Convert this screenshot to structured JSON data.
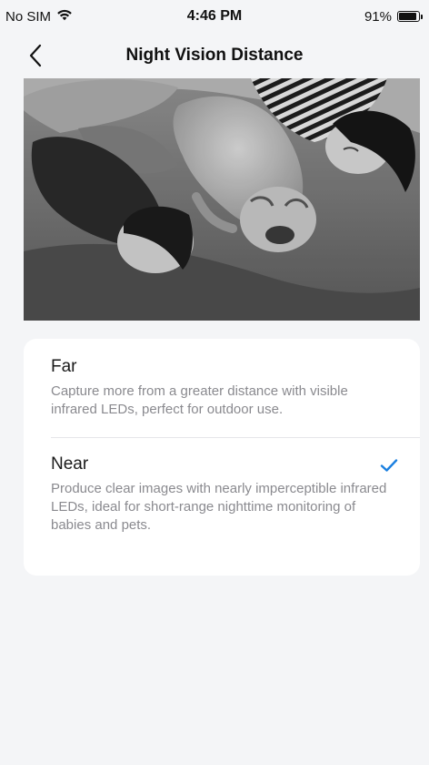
{
  "status_bar": {
    "carrier": "No SIM",
    "time": "4:46 PM",
    "battery_percent": "91%",
    "battery_level": 0.91,
    "wifi_icon": "wifi-icon",
    "battery_icon": "battery-icon"
  },
  "nav": {
    "title": "Night Vision Distance",
    "back_icon": "chevron-left-icon"
  },
  "preview": {
    "description_icon": "camera-preview-image"
  },
  "options": [
    {
      "title": "Far",
      "description": "Capture more from a greater distance with visible infrared LEDs, perfect for outdoor use.",
      "selected": false
    },
    {
      "title": "Near",
      "description": "Produce clear images with nearly imperceptible infrared LEDs, ideal for short-range nighttime monitoring of babies and pets.",
      "selected": true
    }
  ],
  "colors": {
    "accent": "#1a7fe0",
    "background": "#f4f5f7",
    "card": "#ffffff",
    "secondary_text": "#8a8a8f"
  }
}
